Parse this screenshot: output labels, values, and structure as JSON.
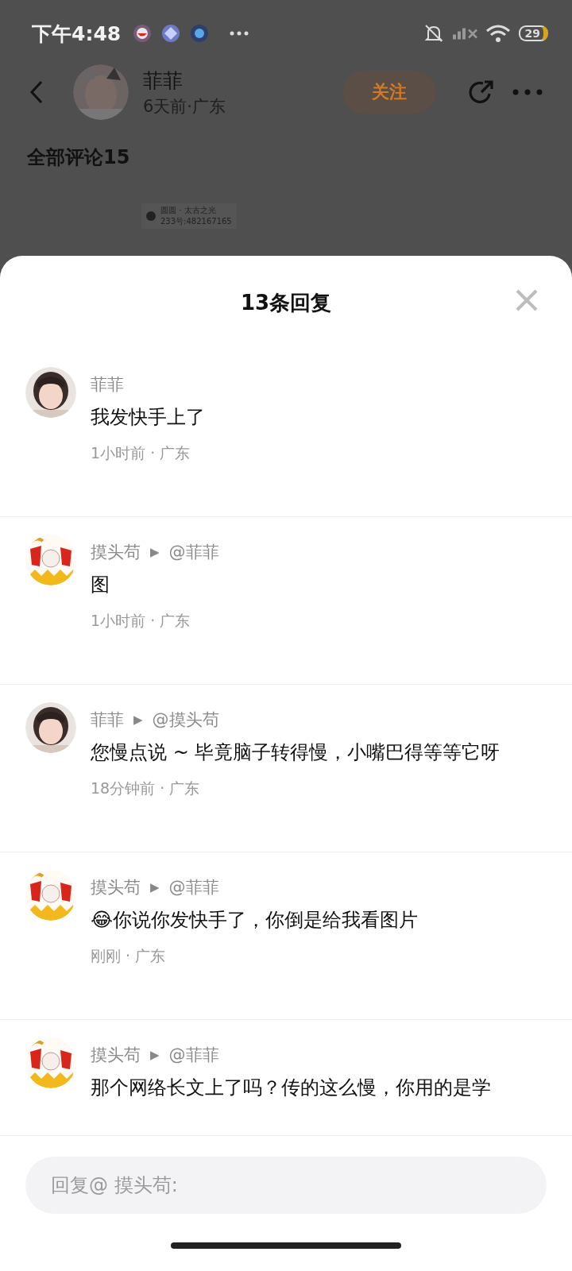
{
  "status_bar": {
    "time": "下午4:48",
    "battery": "29"
  },
  "post": {
    "author": "菲菲",
    "meta": "6天前·广东",
    "follow": "关注",
    "section_title": "全部评论15",
    "image_caption": [
      "圆圆 · 太古之光",
      "233号:482167165"
    ]
  },
  "sheet": {
    "title": "13条回复"
  },
  "replies": [
    {
      "author": "菲菲",
      "text": "我发快手上了",
      "meta": "1小时前 · 广东"
    },
    {
      "kind": "cartoon",
      "author": "摸头苟",
      "arrow": "▶",
      "reply_to": "@菲菲",
      "text": "图",
      "meta": "1小时前 · 广东"
    },
    {
      "author": "菲菲",
      "arrow": "▶",
      "reply_to": "@摸头苟",
      "text": "您慢点说 ~ 毕竟脑子转得慢，小嘴巴得等等它呀",
      "meta": "18分钟前 · 广东"
    },
    {
      "kind": "cartoon",
      "author": "摸头苟",
      "arrow": "▶",
      "reply_to": "@菲菲",
      "text": "😂你说你发快手了，你倒是给我看图片",
      "meta": "刚刚 · 广东"
    },
    {
      "kind": "cartoon",
      "author": "摸头苟",
      "arrow": "▶",
      "reply_to": "@菲菲",
      "text": "那个网络长文上了吗？传的这么慢，你用的是学"
    }
  ],
  "input": {
    "placeholder": "回复@ 摸头苟:"
  }
}
